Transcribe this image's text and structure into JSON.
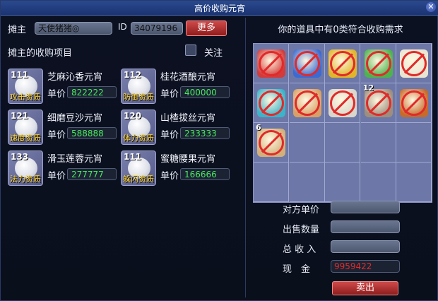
{
  "window": {
    "title": "高价收购元宵"
  },
  "left": {
    "owner_label": "摊主",
    "owner_name": "天使猪猪◎",
    "id_label": "ID",
    "id_value": "34079196",
    "more_button": "更多",
    "section_title": "摊主的收购项目",
    "follow_label": "关注",
    "price_label": "单价",
    "items": [
      {
        "level": "111",
        "name": "芝麻沁香元宵",
        "tag": "攻击资质",
        "price": "822222"
      },
      {
        "level": "112",
        "name": "桂花酒酿元宵",
        "tag": "防御资质",
        "price": "400000"
      },
      {
        "level": "121",
        "name": "细磨豆沙元宵",
        "tag": "速度资质",
        "price": "588888"
      },
      {
        "level": "120",
        "name": "山楂拔丝元宵",
        "tag": "体力资质",
        "price": "233333"
      },
      {
        "level": "133",
        "name": "滑玉莲蓉元宵",
        "tag": "法力资质",
        "price": "277777"
      },
      {
        "level": "111",
        "name": "蜜糖腰果元宵",
        "tag": "躲闪资质",
        "price": "166666"
      }
    ]
  },
  "right": {
    "header": "你的道具中有0类符合收购需求",
    "grid_items": [
      {
        "icon": "red-flag-prohibited-icon",
        "count": "",
        "color": "#d33b3b"
      },
      {
        "icon": "blue-flag-prohibited-icon",
        "count": "",
        "color": "#3b6ad3"
      },
      {
        "icon": "yellow-flag-prohibited-icon",
        "count": "",
        "color": "#e0b52a"
      },
      {
        "icon": "green-flag-prohibited-icon",
        "count": "",
        "color": "#4db34d"
      },
      {
        "icon": "white-flag-prohibited-icon",
        "count": "",
        "color": "#e9e4d2"
      },
      {
        "icon": "cyan-flag-prohibited-icon",
        "count": "",
        "color": "#3bb3c9"
      },
      {
        "icon": "food-bowl-prohibited-icon",
        "count": "",
        "color": "#d8a066"
      },
      {
        "icon": "dish-prohibited-icon",
        "count": "",
        "color": "#d9d6cc"
      },
      {
        "icon": "cake-prohibited-icon",
        "count": "12",
        "color": "#9e8e7e"
      },
      {
        "icon": "scroll-prohibited-icon",
        "count": "",
        "color": "#c76a2a"
      },
      {
        "icon": "bread-prohibited-icon",
        "count": "6",
        "color": "#d3b07a"
      }
    ],
    "unit_price_label": "对方单价",
    "quantity_label": "出售数量",
    "total_label": "总 收 入",
    "cash_label": "现　金",
    "cash_value": "9959422",
    "sell_button": "卖出"
  }
}
